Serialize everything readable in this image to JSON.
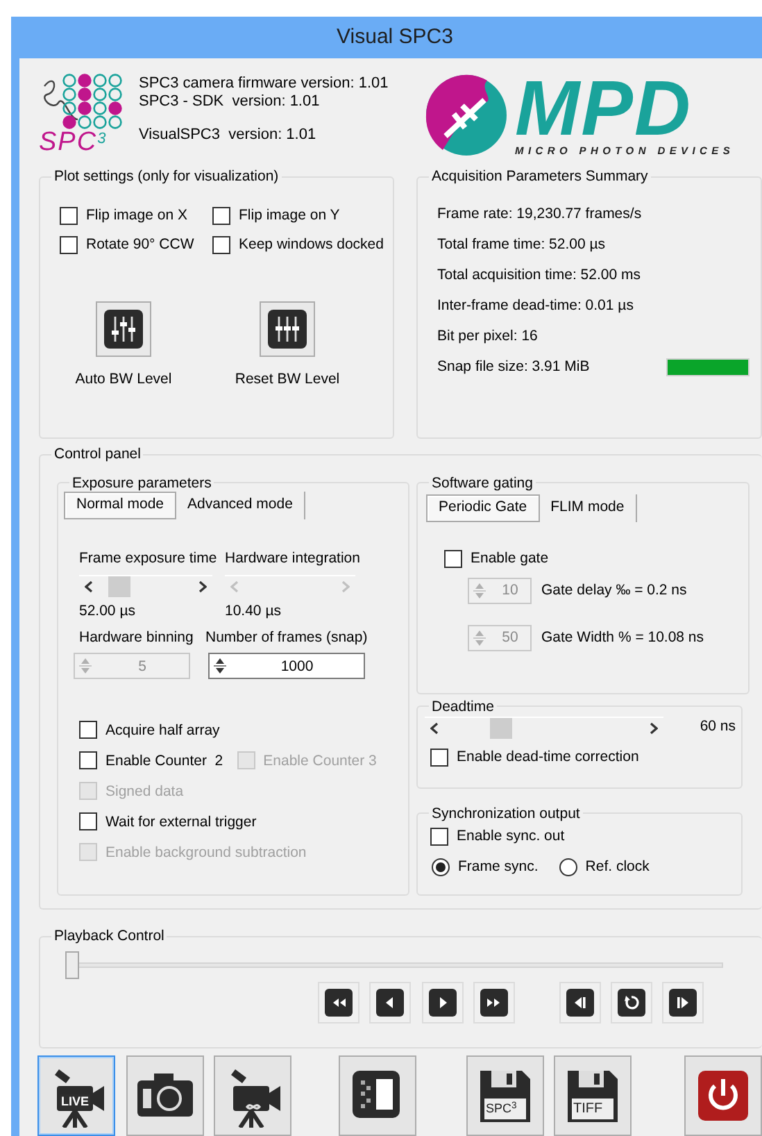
{
  "window": {
    "title": "Visual SPC3"
  },
  "header": {
    "logo_text": "SPC$^{3}$",
    "versions": [
      "SPC3 camera firmware version: 1.01",
      "SPC3 - SDK  version: 1.01",
      "VisualSPC3  version: 1.01"
    ],
    "brand": "MPD",
    "brand_tagline": "MICRO PHOTON DEVICES"
  },
  "plot_settings": {
    "title": "Plot settings (only for visualization)",
    "checkboxes": [
      {
        "label": "Flip image on X",
        "checked": false
      },
      {
        "label": "Flip image on Y",
        "checked": false
      },
      {
        "label": "Rotate 90° CCW",
        "checked": false
      },
      {
        "label": "Keep windows docked",
        "checked": false
      }
    ],
    "buttons": [
      {
        "label": "Auto BW Level"
      },
      {
        "label": "Reset BW Level"
      }
    ]
  },
  "acquisition_summary": {
    "title": "Acquisition Parameters Summary",
    "lines": [
      "Frame rate: 19,230.77 frames/s",
      "Total frame time: 52.00 µs",
      "Total acquisition time: 52.00 ms",
      "Inter-frame dead-time: 0.01 µs",
      "Bit per pixel: 16",
      "Snap file size: 3.91 MiB"
    ]
  },
  "control_panel": {
    "title": "Control panel",
    "exposure": {
      "title": "Exposure parameters",
      "tabs": [
        {
          "label": "Normal mode",
          "selected": true
        },
        {
          "label": "Advanced mode",
          "selected": false
        }
      ],
      "sliders": [
        {
          "label": "Frame exposure time",
          "disabled": false,
          "reading": "52.00 µs"
        },
        {
          "label": "Hardware integration",
          "disabled": true,
          "reading": "10.40 µs"
        }
      ],
      "spinners": [
        {
          "label": "Hardware binning",
          "value": "5",
          "disabled": true
        },
        {
          "label": "Number of frames (snap)",
          "value": "1000",
          "disabled": false
        }
      ],
      "checkbox_rows": [
        [
          {
            "label": "Acquire half array",
            "checked": false,
            "disabled": false
          }
        ],
        [
          {
            "label": "Enable Counter  2",
            "checked": false,
            "disabled": false
          },
          {
            "label": "Enable Counter 3",
            "checked": false,
            "disabled": true
          }
        ],
        [
          {
            "label": "Signed data",
            "checked": false,
            "disabled": true
          }
        ],
        [
          {
            "label": "Wait for external trigger",
            "checked": false,
            "disabled": false
          }
        ],
        [
          {
            "label": "Enable background subtraction",
            "checked": false,
            "disabled": true
          }
        ]
      ]
    },
    "gating": {
      "title": "Software gating",
      "tabs": [
        {
          "label": "Periodic Gate",
          "selected": true
        },
        {
          "label": "FLIM mode",
          "selected": false
        }
      ],
      "enable": {
        "label": "Enable gate",
        "checked": false
      },
      "spinners": [
        {
          "value": "10",
          "label": "Gate delay ‰ = 0.2 ns",
          "disabled": true
        },
        {
          "value": "50",
          "label": "Gate Width % = 10.08 ns",
          "disabled": true
        }
      ]
    },
    "deadtime": {
      "title": "Deadtime",
      "reading": "60 ns",
      "correction": {
        "label": "Enable dead-time correction",
        "checked": false
      }
    },
    "sync": {
      "title": "Synchronization output",
      "enable": {
        "label": "Enable sync. out",
        "checked": false
      },
      "radios": [
        {
          "label": "Frame sync.",
          "selected": true
        },
        {
          "label": "Ref. clock",
          "selected": false
        }
      ]
    }
  },
  "playback": {
    "title": "Playback Control",
    "level": 0,
    "buttons": [
      {
        "kind": "rewind"
      },
      {
        "kind": "back"
      },
      {
        "kind": "play"
      },
      {
        "kind": "forward"
      },
      {
        "kind": "step_back"
      },
      {
        "kind": "repeat"
      },
      {
        "kind": "step_forward"
      }
    ]
  },
  "toolbar": [
    {
      "kind": "live",
      "label": "LIVE",
      "selected": true
    },
    {
      "kind": "snapshot",
      "selected": false
    },
    {
      "kind": "loop",
      "selected": false
    },
    {
      "kind": "load",
      "selected": false
    },
    {
      "kind": "save",
      "label": "SPC$^{3}$",
      "selected": false
    },
    {
      "kind": "save",
      "label": "TIFF",
      "selected": false
    },
    {
      "kind": "power",
      "selected": false
    }
  ]
}
